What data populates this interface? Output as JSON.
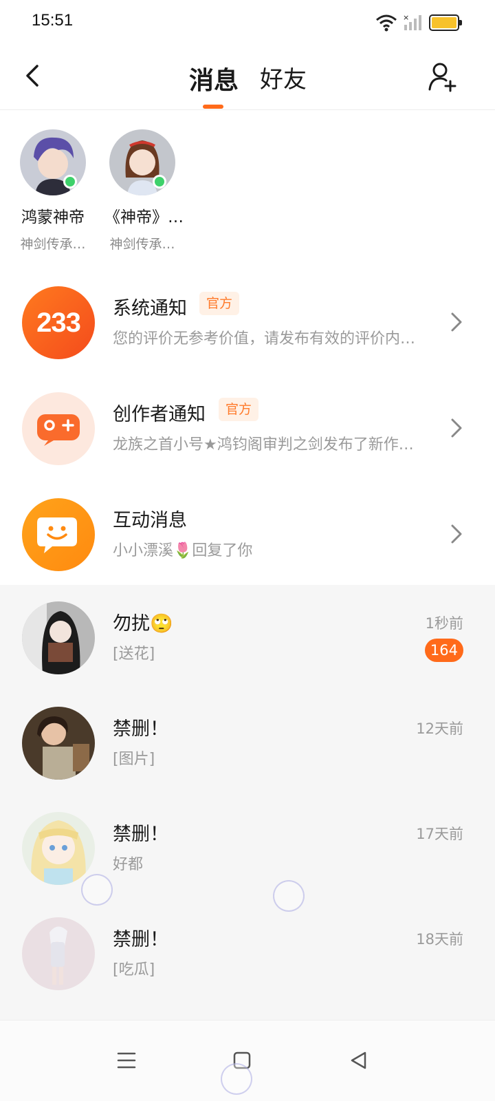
{
  "status_bar": {
    "time": "15:51",
    "battery_color": "#f7c22b"
  },
  "header": {
    "tabs": [
      {
        "label": "消息",
        "active": true
      },
      {
        "label": "好友",
        "active": false
      }
    ],
    "accent_color": "#ff6a1a"
  },
  "online_users": [
    {
      "name": "鸿蒙神帝",
      "subtitle": "神剑传承…",
      "online": true
    },
    {
      "name": "《神帝》…",
      "subtitle": "神剑传承…",
      "online": true
    }
  ],
  "notifications": [
    {
      "title": "系统通知",
      "badge": "官方",
      "preview": "您的评价无参考价值，请发布有效的评价内…",
      "icon": "233-logo-icon",
      "icon_text": "233"
    },
    {
      "title": "创作者通知",
      "badge": "官方",
      "preview": "龙族之首小号★鸿钧阁审判之剑发布了新作…",
      "icon": "gamepad-icon"
    },
    {
      "title": "互动消息",
      "badge": "",
      "preview": "小小漂溪🌷回复了你",
      "icon": "chat-bubble-icon"
    }
  ],
  "chats": [
    {
      "name": "勿扰🙄",
      "message": "[送花]",
      "time": "1秒前",
      "unread": "164"
    },
    {
      "name": "禁删！",
      "message": "[图片]",
      "time": "12天前",
      "unread": ""
    },
    {
      "name": "禁删！",
      "message": "好都",
      "time": "17天前",
      "unread": ""
    },
    {
      "name": "禁删！",
      "message": "[吃瓜]",
      "time": "18天前",
      "unread": ""
    }
  ],
  "nav_bar": {
    "buttons": [
      "menu-icon",
      "home-icon",
      "back-triangle-icon"
    ]
  }
}
